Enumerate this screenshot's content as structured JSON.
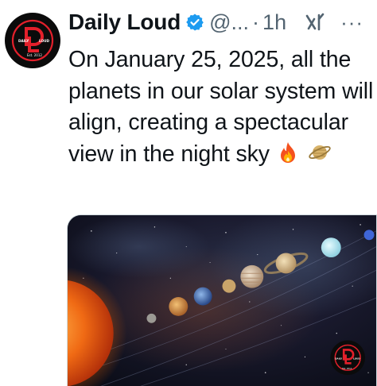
{
  "tweet": {
    "author_name": "Daily Loud",
    "handle": "@...",
    "separator": "·",
    "time": "1h",
    "more_label": "···",
    "text": "On January 25, 2025, all the planets in our solar system will align, creating a spectacular view in the night sky",
    "emoji_icons": [
      "fire-icon",
      "ringed-planet-icon"
    ]
  },
  "avatar_logo": {
    "left_text": "DAILY",
    "right_text": "LOUD",
    "bottom_text": "Est. 2012",
    "monogram": "DL"
  },
  "colors": {
    "verified_blue": "#1d9bf0",
    "secondary_text": "#536471",
    "logo_red": "#e3202b"
  }
}
